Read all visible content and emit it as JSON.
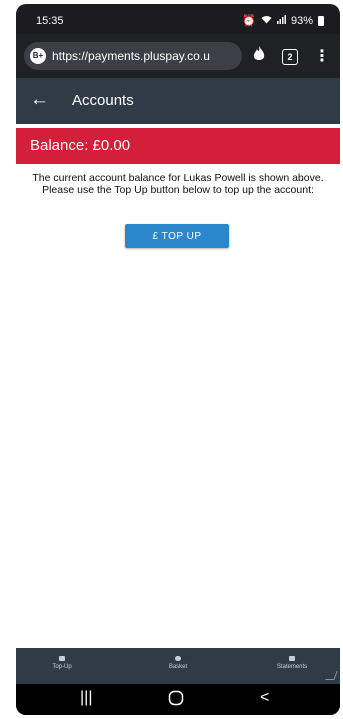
{
  "status_bar": {
    "time": "15:35",
    "battery": "93%"
  },
  "browser": {
    "site_icon_text": "B+",
    "url": "https://payments.pluspay.co.u",
    "tab_count": "2"
  },
  "app_bar": {
    "title": "Accounts"
  },
  "balance": {
    "text": "Balance: £0.00"
  },
  "message": "The current account balance for Lukas Powell is shown above. Please use the Top Up button below to top up the account:",
  "topup_button_label": "£ TOP UP",
  "bottom_nav": {
    "items": [
      {
        "label": "Top-Up",
        "icon": "topup-icon"
      },
      {
        "label": "Basket",
        "icon": "basket-icon"
      },
      {
        "label": "Statements",
        "icon": "statements-icon"
      }
    ]
  },
  "colors": {
    "app_bar": "#2f3b47",
    "balance_banner": "#d41f3a",
    "button": "#2a87cc"
  }
}
